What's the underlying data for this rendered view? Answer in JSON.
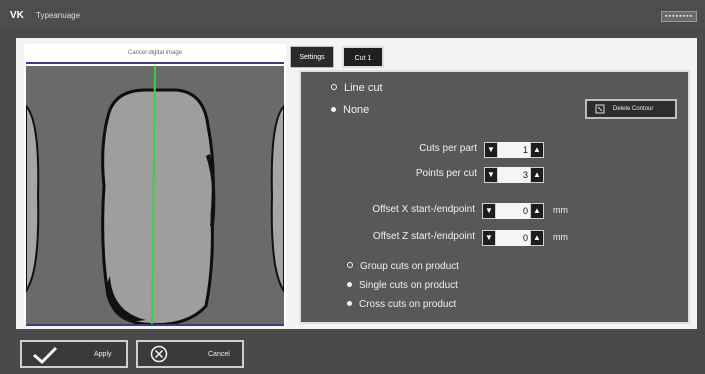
{
  "window": {
    "logo": "VK",
    "title": "Typeanuage",
    "controls": "▪▪▪▪▪▪▪▪"
  },
  "image_panel": {
    "title": "Cancel digital image"
  },
  "tabs": [
    {
      "label": "Settings"
    },
    {
      "label": "Cut 1"
    }
  ],
  "cut_mode": {
    "options": [
      {
        "label": "Line cut",
        "selected": false
      },
      {
        "label": "None",
        "selected": true
      }
    ]
  },
  "delete_button": {
    "label": "Delete Contour"
  },
  "fields": {
    "cuts_per_part": {
      "label": "Cuts per part",
      "value": "1"
    },
    "points_per_cut": {
      "label": "Points per cut",
      "value": "3"
    },
    "offset_x": {
      "label": "Offset X start-/endpoint",
      "value": "0",
      "unit": "mm"
    },
    "offset_z": {
      "label": "Offset Z start-/endpoint",
      "value": "0",
      "unit": "mm"
    }
  },
  "cut_grouping": {
    "options": [
      {
        "label": "Group cuts on product",
        "selected": false
      },
      {
        "label": "Single cuts on product",
        "selected": true
      },
      {
        "label": "Cross cuts on product",
        "selected": true
      }
    ]
  },
  "bottom": {
    "apply_label": "Apply",
    "cancel_label": "Cancel"
  },
  "colors": {
    "settings_bg": "#585858",
    "cut_line": "#35d24a",
    "frame_line": "#3c3c7a"
  }
}
